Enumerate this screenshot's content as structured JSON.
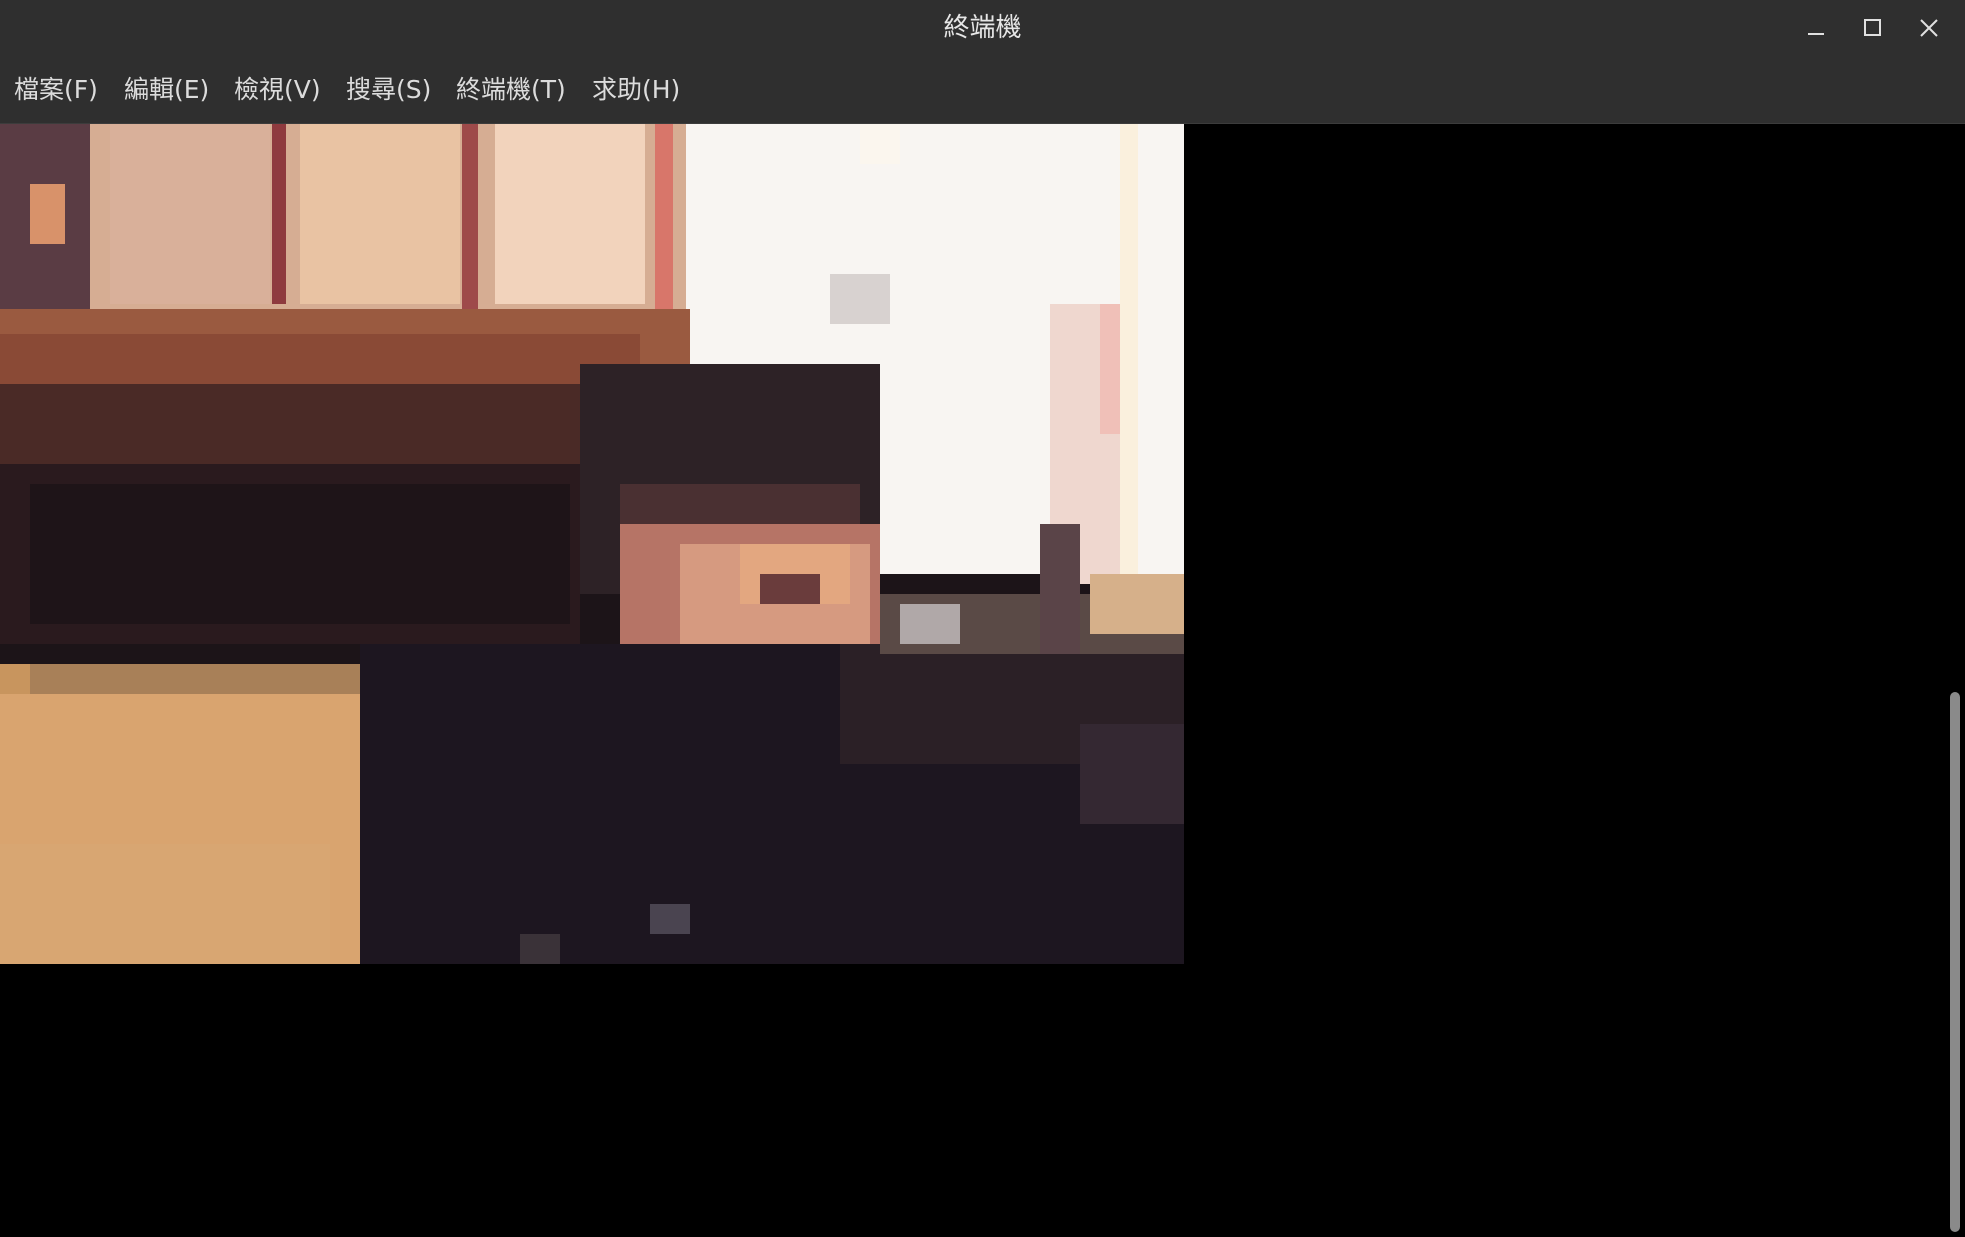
{
  "window": {
    "title": "終端機",
    "controls": {
      "minimize_icon": "minimize-icon",
      "maximize_icon": "maximize-icon",
      "close_icon": "close-icon"
    }
  },
  "menubar": {
    "items": [
      {
        "label": "檔案(F)"
      },
      {
        "label": "編輯(E)"
      },
      {
        "label": "檢視(V)"
      },
      {
        "label": "搜尋(S)"
      },
      {
        "label": "終端機(T)"
      },
      {
        "label": "求助(H)"
      }
    ]
  },
  "terminal": {
    "content": "pixelated-webcam-image",
    "background_color": "#000000",
    "scrollbar": {
      "position_fraction": 0.55,
      "visible_fraction": 0.43
    }
  },
  "colors": {
    "titlebar_bg": "#2f2f2f",
    "menu_text": "#dcdcdc",
    "title_text": "#e6e6e6"
  }
}
